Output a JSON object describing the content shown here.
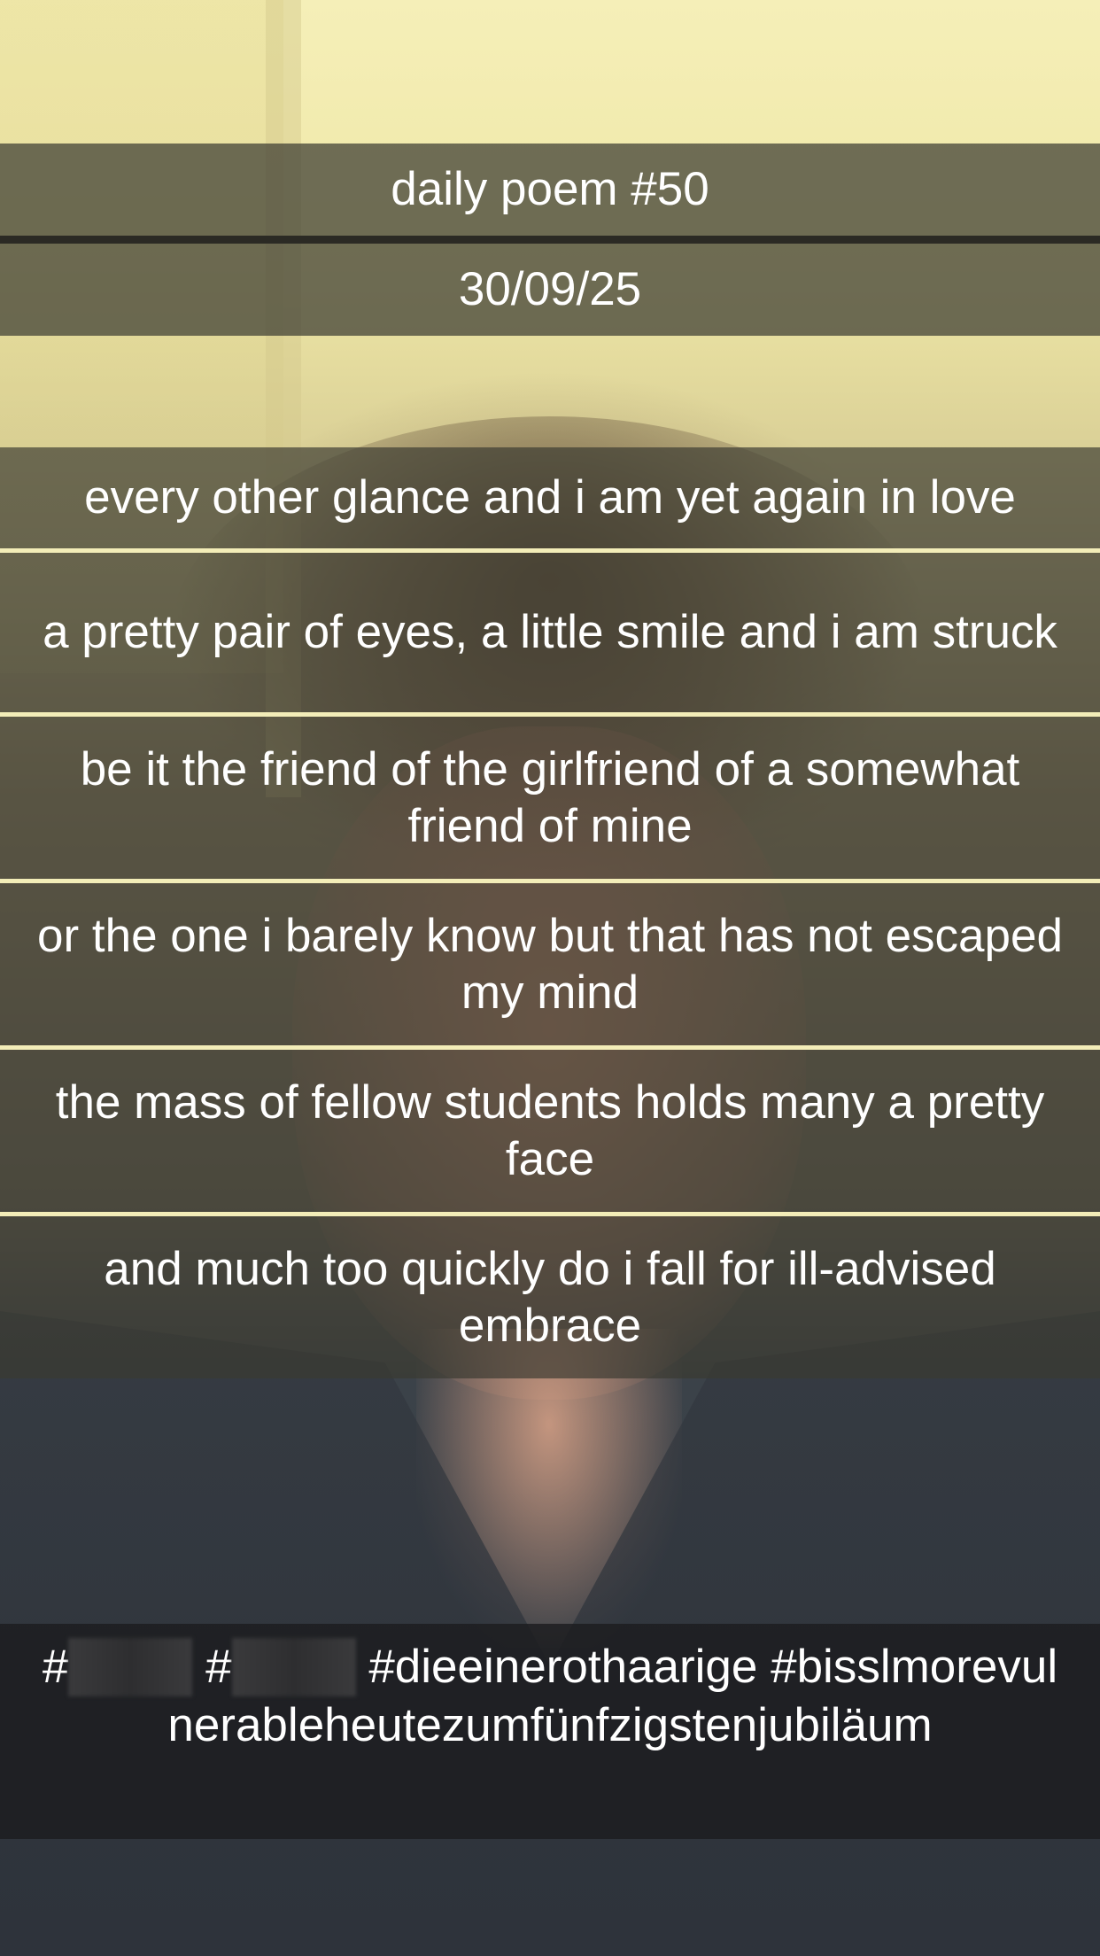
{
  "header": {
    "title": "daily poem #50",
    "date": "30/09/25"
  },
  "poem": {
    "lines": [
      "every other glance and i am yet again in love",
      "a pretty pair of eyes, a little smile and i am struck",
      "be it the friend of the girlfriend of a somewhat friend of mine",
      "or the one i barely know but that has not escaped my mind",
      "the mass of fellow students holds many a pretty face",
      "and much too quickly do i fall for ill-advised embrace"
    ]
  },
  "hashtags": {
    "hash_1": "#",
    "redacted_1": "greta",
    "hash_2": "#",
    "redacted_2": "anna",
    "tag_3": "#dieeinerothaarige",
    "tag_4": "#bisslmorevulnerableheutezumfünfzigstenjubiläum"
  },
  "colors": {
    "band_background": "#3c3c32",
    "separator_light": "#f3edb8",
    "separator_dark": "#2b2a24",
    "text": "#ffffff",
    "hashtag_background": "#1c1c1e"
  }
}
